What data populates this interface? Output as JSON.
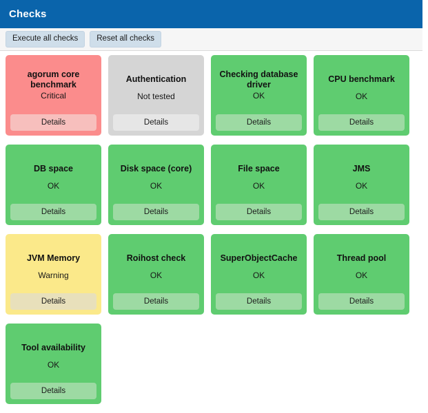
{
  "header": {
    "title": "Checks",
    "bar_color": "#0a64ab"
  },
  "toolbar": {
    "execute_all_label": "Execute all checks",
    "reset_all_label": "Reset all checks"
  },
  "common": {
    "details_label": "Details"
  },
  "status_colors": {
    "ok": "#5fcc70",
    "critical": "#fb8c8c",
    "warning": "#fbe98a",
    "not_tested": "#d5d5d5"
  },
  "checks": [
    {
      "title": "agorum core benchmark",
      "status": "Critical",
      "state": "critical",
      "details_label": "Details"
    },
    {
      "title": "Authentication",
      "status": "Not tested",
      "state": "nottested",
      "details_label": "Details"
    },
    {
      "title": "Checking database driver",
      "status": "OK",
      "state": "ok",
      "details_label": "Details"
    },
    {
      "title": "CPU benchmark",
      "status": "OK",
      "state": "ok",
      "details_label": "Details"
    },
    {
      "title": "DB space",
      "status": "OK",
      "state": "ok",
      "details_label": "Details"
    },
    {
      "title": "Disk space (core)",
      "status": "OK",
      "state": "ok",
      "details_label": "Details"
    },
    {
      "title": "File space",
      "status": "OK",
      "state": "ok",
      "details_label": "Details"
    },
    {
      "title": "JMS",
      "status": "OK",
      "state": "ok",
      "details_label": "Details"
    },
    {
      "title": "JVM Memory",
      "status": "Warning",
      "state": "warning",
      "details_label": "Details"
    },
    {
      "title": "Roihost check",
      "status": "OK",
      "state": "ok",
      "details_label": "Details"
    },
    {
      "title": "SuperObjectCache",
      "status": "OK",
      "state": "ok",
      "details_label": "Details"
    },
    {
      "title": "Thread pool",
      "status": "OK",
      "state": "ok",
      "details_label": "Details"
    },
    {
      "title": "Tool availability",
      "status": "OK",
      "state": "ok",
      "details_label": "Details"
    }
  ]
}
